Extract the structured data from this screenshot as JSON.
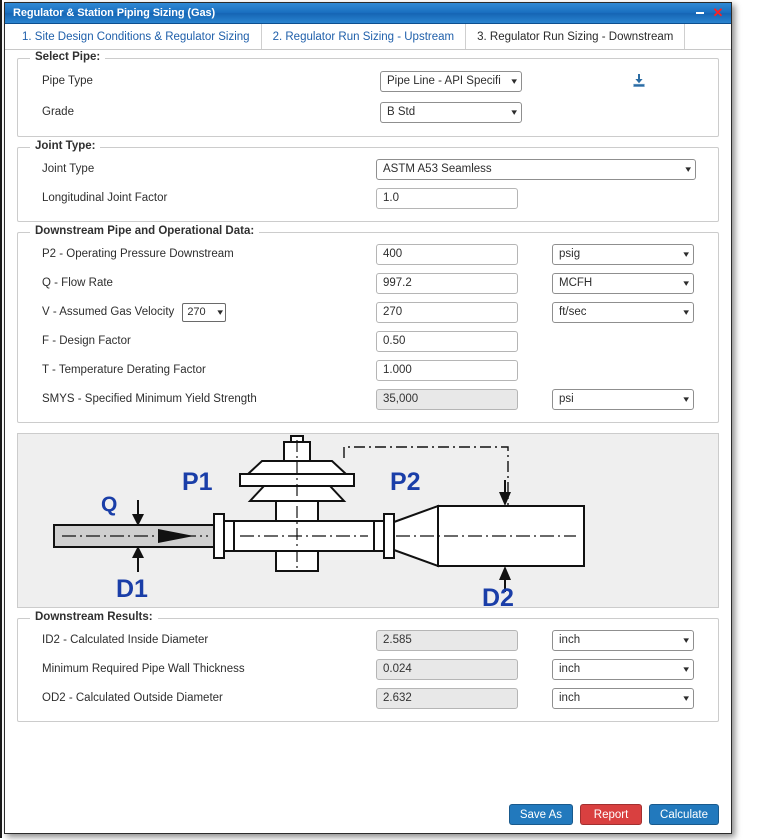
{
  "window": {
    "title": "Regulator & Station Piping Sizing (Gas)",
    "minimize_label": "–",
    "close_label": "✕"
  },
  "tabs": [
    {
      "label": "1. Site Design Conditions & Regulator Sizing",
      "active": false
    },
    {
      "label": "2. Regulator Run Sizing - Upstream",
      "active": false
    },
    {
      "label": "3. Regulator Run Sizing - Downstream",
      "active": true
    }
  ],
  "select_pipe": {
    "legend": "Select Pipe:",
    "pipe_type_label": "Pipe Type",
    "pipe_type_value": "Pipe Line - API Specifi",
    "grade_label": "Grade",
    "grade_value": "B Std",
    "download_icon": "download-icon"
  },
  "joint_type": {
    "legend": "Joint Type:",
    "joint_type_label": "Joint Type",
    "joint_type_value": "ASTM A53 Seamless",
    "factor_label": "Longitudinal Joint Factor",
    "factor_value": "1.0"
  },
  "downstream_data": {
    "legend": "Downstream Pipe and Operational Data:",
    "rows": [
      {
        "label": "P2 - Operating Pressure Downstream",
        "value": "400",
        "unit": "psig",
        "readonly": false,
        "has_unit": true
      },
      {
        "label": "Q - Flow Rate",
        "value": "997.2",
        "unit": "MCFH",
        "readonly": false,
        "has_unit": true
      },
      {
        "label": "V - Assumed Gas Velocity",
        "value": "270",
        "unit": "ft/sec",
        "readonly": false,
        "has_unit": true,
        "mini_select": "270"
      },
      {
        "label": "F - Design Factor",
        "value": "0.50",
        "unit": "",
        "readonly": false,
        "has_unit": false
      },
      {
        "label": "T - Temperature Derating Factor",
        "value": "1.000",
        "unit": "",
        "readonly": false,
        "has_unit": false
      },
      {
        "label": "SMYS - Specified Minimum Yield Strength",
        "value": "35,000",
        "unit": "psi",
        "readonly": true,
        "has_unit": true
      }
    ]
  },
  "diagram": {
    "labels": {
      "q": "Q",
      "p1": "P1",
      "p2": "P2",
      "d1": "D1",
      "d2": "D2"
    },
    "label_color": "#1a3ea8",
    "accent_color": "#e8a33d"
  },
  "results": {
    "legend": "Downstream Results:",
    "rows": [
      {
        "label": "ID2 - Calculated Inside Diameter",
        "value": "2.585",
        "unit": "inch"
      },
      {
        "label": "Minimum Required Pipe Wall Thickness",
        "value": "0.024",
        "unit": "inch"
      },
      {
        "label": "OD2 - Calculated Outside Diameter",
        "value": "2.632",
        "unit": "inch"
      }
    ]
  },
  "footer": {
    "save_as": "Save As",
    "report": "Report",
    "calculate": "Calculate"
  },
  "colors": {
    "title_bar": "#1a6fc0",
    "primary_button": "#2279bd",
    "danger_button": "#d94040",
    "tab_link": "#1f5faa",
    "readonly_field": "#e8e8e8"
  }
}
